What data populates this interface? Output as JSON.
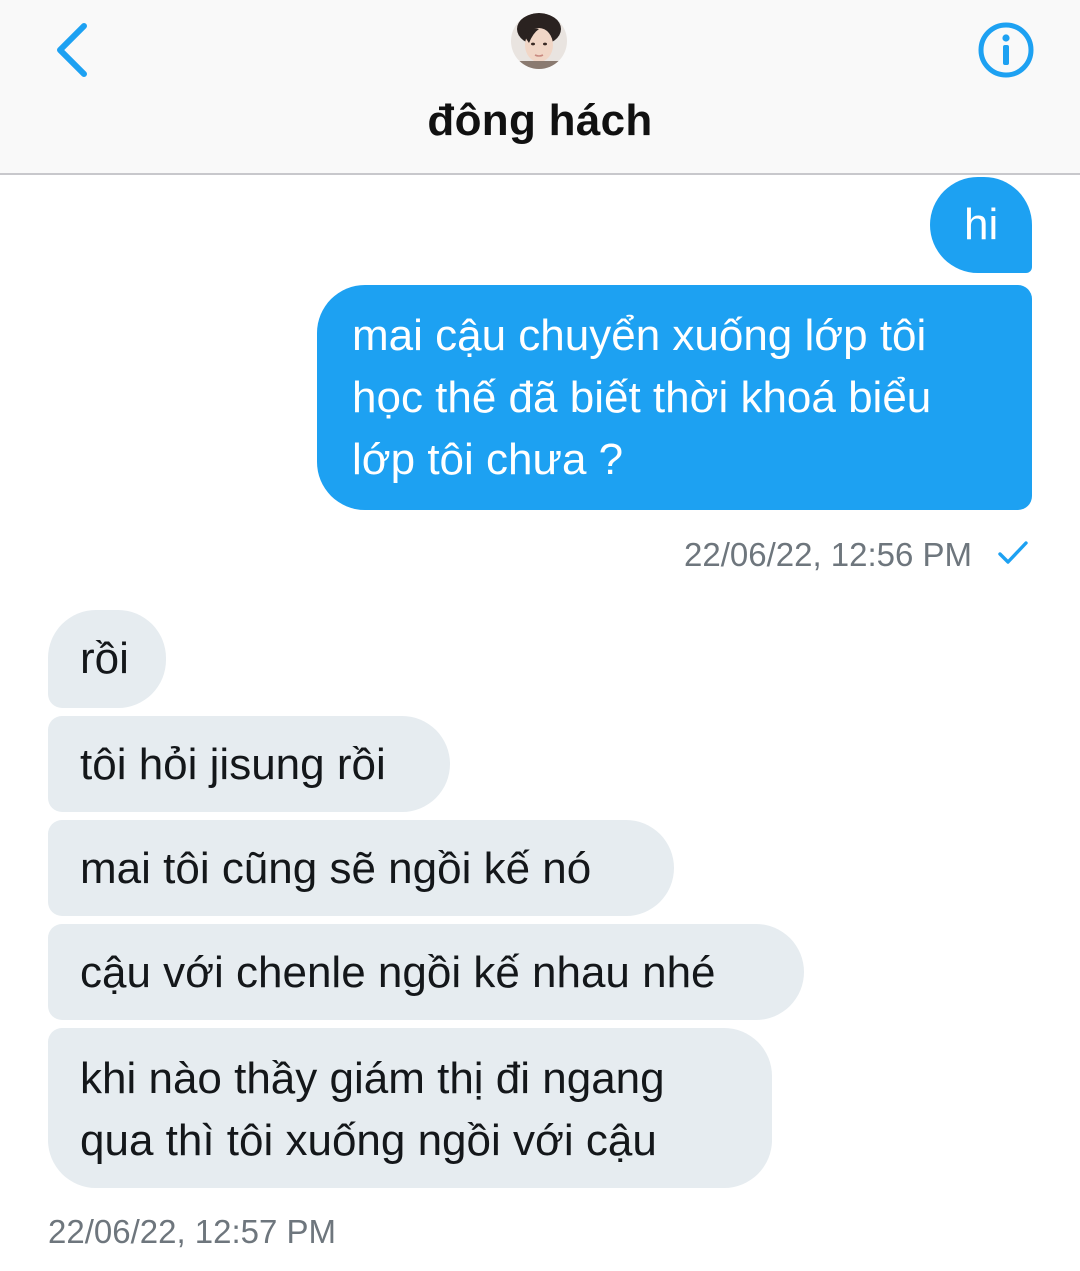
{
  "header": {
    "contact_name": "đông hách",
    "back_icon": "chevron-left-icon",
    "info_icon": "info-circle-icon",
    "accent_color": "#1da1f2"
  },
  "messages": {
    "sent": [
      {
        "text": "hi"
      },
      {
        "text_lines": [
          "mai cậu chuyển xuống lớp tôi",
          "học thế đã biết thời khoá biểu",
          "lớp tôi chưa ?"
        ]
      }
    ],
    "sent_timestamp": "22/06/22, 12:56 PM",
    "sent_status_icon": "checkmark-icon",
    "received": [
      {
        "text": "rồi"
      },
      {
        "text": "tôi hỏi jisung rồi"
      },
      {
        "text": "mai tôi cũng sẽ ngồi kế nó"
      },
      {
        "text": "cậu với chenle ngồi kế nhau nhé"
      },
      {
        "text_lines": [
          "khi nào thầy giám thị đi ngang",
          "qua thì tôi xuống ngồi với cậu"
        ]
      }
    ],
    "received_timestamp": "22/06/22, 12:57 PM"
  },
  "colors": {
    "sent_bubble": "#1da1f2",
    "received_bubble": "#e6ecf0",
    "timestamp": "#6e767d"
  }
}
